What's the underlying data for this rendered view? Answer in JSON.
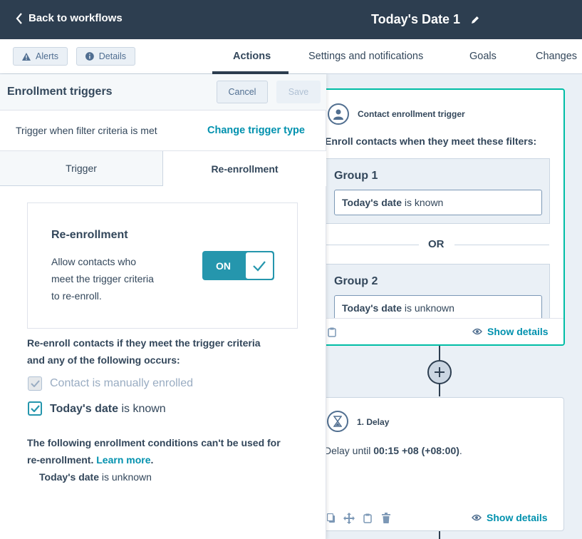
{
  "topbar": {
    "back_label": "Back to workflows",
    "workflow_title": "Today's Date 1"
  },
  "toolbar": {
    "alerts_label": "Alerts",
    "details_label": "Details"
  },
  "tabs": [
    {
      "label": "Actions"
    },
    {
      "label": "Settings and notifications"
    },
    {
      "label": "Goals"
    },
    {
      "label": "Changes"
    }
  ],
  "panel": {
    "title": "Enrollment triggers",
    "cancel_label": "Cancel",
    "save_label": "Save",
    "trigger_text": "Trigger when filter criteria is met",
    "change_trigger_label": "Change trigger type",
    "subtabs": [
      {
        "label": "Trigger"
      },
      {
        "label": "Re-enrollment"
      }
    ],
    "reenroll_box": {
      "heading": "Re-enrollment",
      "desc_line1": "Allow contacts who",
      "desc_line2": "meet the trigger criteria",
      "desc_line3": "to re-enroll.",
      "toggle_label": "ON"
    },
    "criteria_line1": "Re-enroll contacts if they meet the trigger criteria",
    "criteria_line2": "and any of the following occurs:",
    "option1": "Contact is manually enrolled",
    "option2_prop": "Today's date",
    "option2_rest": "is known",
    "note_line1": "The following enrollment conditions can't be used for",
    "note_line2": "re-enrollment.",
    "learn_more": "Learn more",
    "note_end": ".",
    "condition_prop": "Today's date",
    "condition_rest": "is unknown"
  },
  "canvas": {
    "trigger_card": {
      "title": "Contact enrollment trigger",
      "desc": "Enroll contacts when they meet these filters:",
      "group1": {
        "title": "Group 1",
        "prop": "Today's date",
        "rest": "is known"
      },
      "or_label": "OR",
      "group2": {
        "title": "Group 2",
        "prop": "Today's date",
        "rest": "is unknown"
      },
      "show_details": "Show details"
    },
    "delay_card": {
      "title": "1. Delay",
      "text_before": "Delay until",
      "time": "00:15 +08 (+08:00)",
      "text_after": ".",
      "show_details": "Show details"
    }
  },
  "colors": {
    "header_bg": "#2d3e50",
    "accent_teal": "#0091ae",
    "toggle_bg": "#2596ad",
    "trigger_border": "#00bda5"
  }
}
